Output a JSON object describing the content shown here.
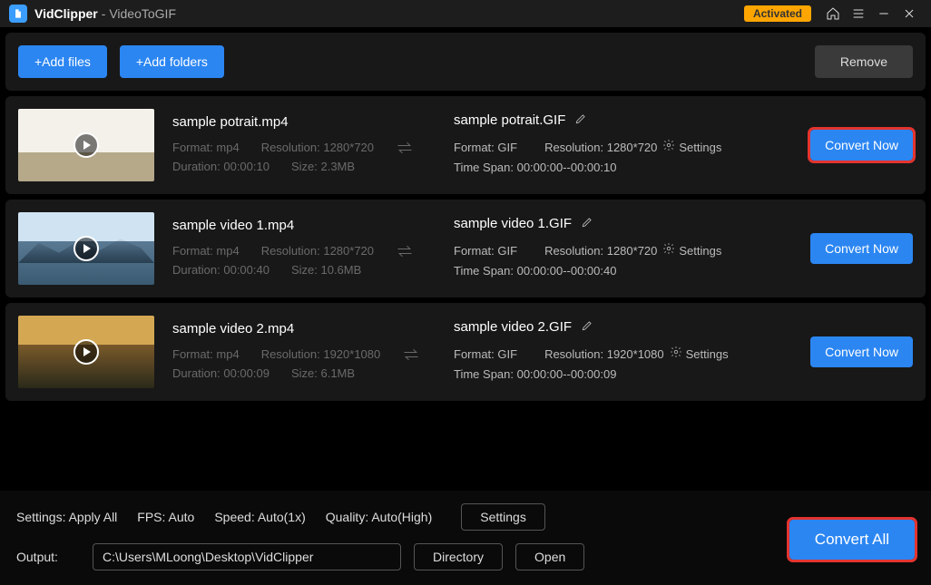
{
  "title": {
    "app": "VidClipper",
    "sub": "VideoToGIF",
    "activated": "Activated"
  },
  "toolbar": {
    "add_files": "+Add files",
    "add_folders": "+Add folders",
    "remove": "Remove"
  },
  "items": [
    {
      "src_name": "sample potrait.mp4",
      "src_format": "Format: mp4",
      "src_res": "Resolution: 1280*720",
      "src_dur": "Duration: 00:00:10",
      "src_size": "Size: 2.3MB",
      "out_name": "sample potrait.GIF",
      "out_format": "Format: GIF",
      "out_res": "Resolution: 1280*720",
      "out_settings": "Settings",
      "out_span": "Time Span: 00:00:00--00:00:10",
      "convert": "Convert Now",
      "highlight": true
    },
    {
      "src_name": "sample video 1.mp4",
      "src_format": "Format: mp4",
      "src_res": "Resolution: 1280*720",
      "src_dur": "Duration: 00:00:40",
      "src_size": "Size: 10.6MB",
      "out_name": "sample video 1.GIF",
      "out_format": "Format: GIF",
      "out_res": "Resolution: 1280*720",
      "out_settings": "Settings",
      "out_span": "Time Span: 00:00:00--00:00:40",
      "convert": "Convert Now",
      "highlight": false
    },
    {
      "src_name": "sample video 2.mp4",
      "src_format": "Format: mp4",
      "src_res": "Resolution: 1920*1080",
      "src_dur": "Duration: 00:00:09",
      "src_size": "Size: 6.1MB",
      "out_name": "sample video 2.GIF",
      "out_format": "Format: GIF",
      "out_res": "Resolution: 1920*1080",
      "out_settings": "Settings",
      "out_span": "Time Span: 00:00:00--00:00:09",
      "convert": "Convert Now",
      "highlight": false
    }
  ],
  "footer": {
    "settings_label": "Settings: Apply All",
    "fps": "FPS: Auto",
    "speed": "Speed: Auto(1x)",
    "quality": "Quality: Auto(High)",
    "settings_btn": "Settings",
    "output_label": "Output:",
    "output_path": "C:\\Users\\MLoong\\Desktop\\VidClipper",
    "directory": "Directory",
    "open": "Open",
    "convert_all": "Convert All"
  }
}
